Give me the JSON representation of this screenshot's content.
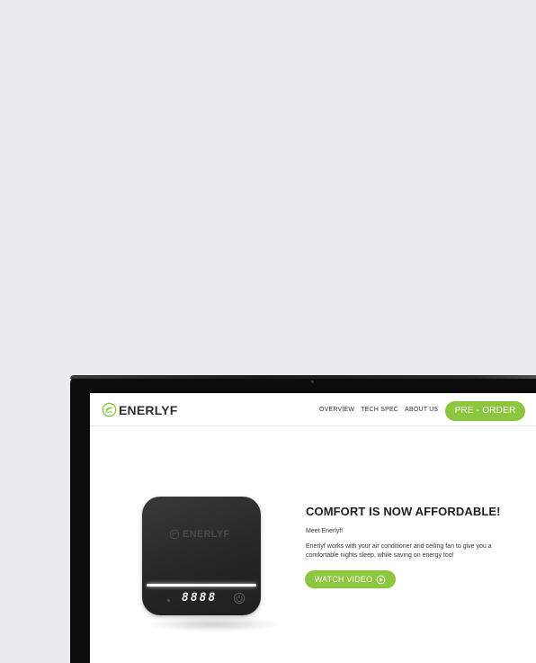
{
  "site": {
    "logo_text": "ENERLYF",
    "nav": [
      "OVERVIEW",
      "TECH SPEC",
      "ABOUT US"
    ],
    "preorder_label": "PRE - ORDER"
  },
  "hero": {
    "title": "COMFORT IS NOW AFFORDABLE!",
    "greeting": "Meet Enerlyf!",
    "description": "Enerlyf works with your air conditioner and ceiling fan to give you a comfortable nights sleep, while saving on energy too!",
    "watch_label": "WATCH VIDEO"
  },
  "device": {
    "brand_text": "ENERLYF",
    "display": "8888"
  },
  "icons": {
    "logo": "leaf-circle-icon",
    "play": "play-circle-icon",
    "power": "power-icon"
  },
  "colors": {
    "accent": "#8cc63f",
    "background": "#ececef",
    "device": "#262626"
  }
}
